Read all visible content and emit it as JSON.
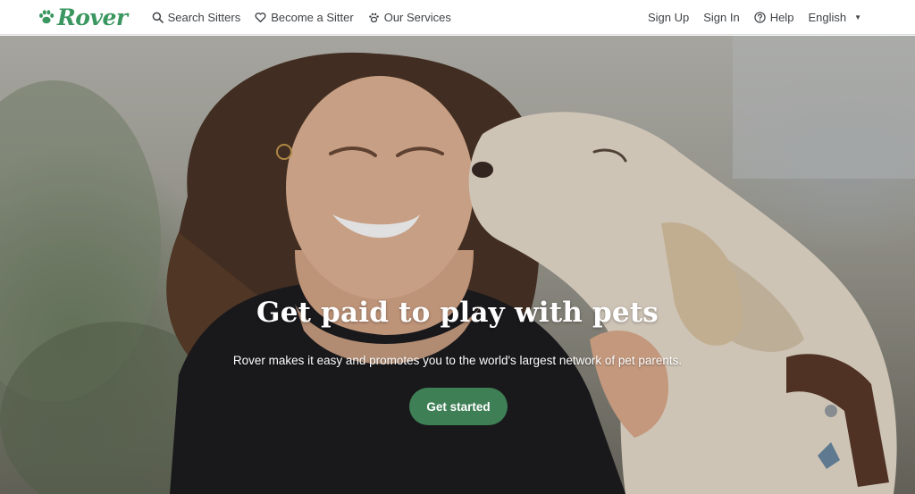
{
  "header": {
    "logo_text": "Rover",
    "nav_left": [
      {
        "label": "Search Sitters",
        "icon": "search-icon"
      },
      {
        "label": "Become a Sitter",
        "icon": "heart-icon"
      },
      {
        "label": "Our Services",
        "icon": "paw-icon"
      }
    ],
    "nav_right": {
      "sign_up": "Sign Up",
      "sign_in": "Sign In",
      "help": "Help",
      "help_icon": "question-circle-icon",
      "language": "English",
      "language_icon": "caret-down-icon"
    }
  },
  "hero": {
    "title": "Get paid to play with pets",
    "subtitle": "Rover makes it easy and promotes you to the world's largest network of pet parents.",
    "cta_label": "Get started"
  },
  "colors": {
    "brand_green": "#3b9760",
    "cta_green": "#3e7f55",
    "nav_text": "#404347"
  }
}
